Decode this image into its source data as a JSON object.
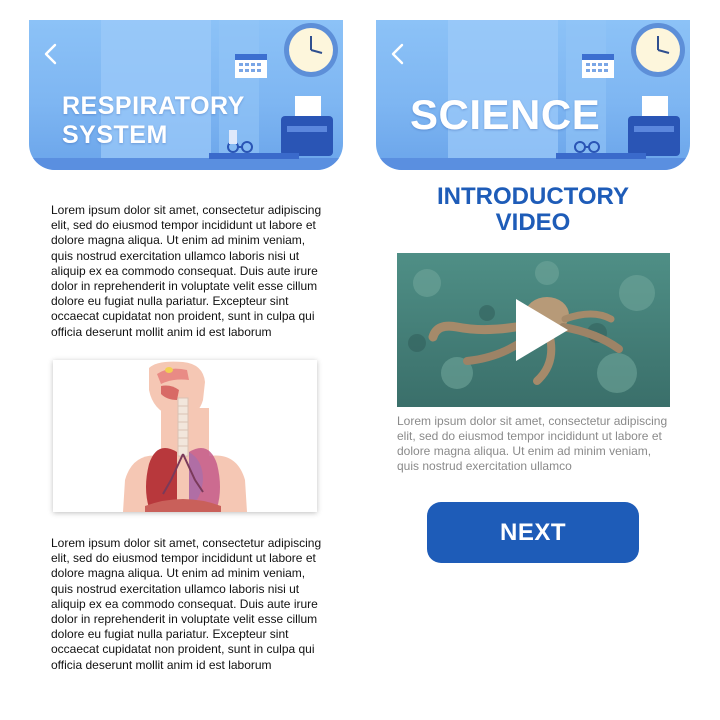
{
  "left_screen": {
    "header": {
      "title": "RESPIRATORY SYSTEM"
    },
    "paragraph_1": "Lorem ipsum dolor sit amet, consectetur adipiscing elit, sed do eiusmod tempor incididunt ut labore et dolore magna aliqua. Ut enim ad minim veniam, quis nostrud exercitation ullamco laboris nisi ut aliquip ex ea commodo consequat. Duis aute irure dolor in reprehenderit in voluptate velit esse cillum dolore eu fugiat nulla pariatur. Excepteur sint occaecat cupidatat non proident, sunt in culpa qui officia deserunt mollit anim id est laborum",
    "paragraph_2": "Lorem ipsum dolor sit amet, consectetur adipiscing elit, sed do eiusmod tempor incididunt ut labore et dolore magna aliqua. Ut enim ad minim veniam, quis nostrud exercitation ullamco laboris nisi ut aliquip ex ea commodo consequat. Duis aute irure dolor in reprehenderit in voluptate velit esse cillum dolore eu fugiat nulla pariatur. Excepteur sint occaecat cupidatat non proident, sunt in culpa qui officia deserunt mollit anim id est laborum"
  },
  "right_screen": {
    "header": {
      "title": "SCIENCE"
    },
    "section_title": "INTRODUCTORY VIDEO",
    "video_caption": "Lorem ipsum dolor sit amet, consectetur adipiscing elit, sed do eiusmod tempor incididunt ut labore et dolore magna aliqua. Ut enim ad minim veniam, quis nostrud exercitation ullamco",
    "next_label": "NEXT"
  },
  "icons": [
    "chevron-left-icon",
    "clock-icon",
    "calendar-icon",
    "printer-icon",
    "glasses-icon",
    "play-icon"
  ],
  "colors": {
    "accent": "#1e5cb8",
    "banner": "#8cc2f7",
    "caption_text": "#8a8a8a"
  }
}
